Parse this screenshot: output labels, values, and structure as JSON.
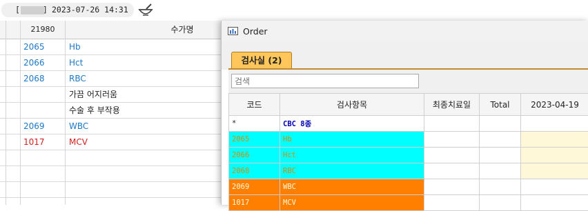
{
  "topbar": {
    "bracket_open": "[",
    "bracket_close": "]",
    "datetime": "2023-07-26 14:31",
    "bowl_icon": "mortar-pestle-icon"
  },
  "grid": {
    "header_code": "21980",
    "header_name": "수가명",
    "rows": [
      {
        "code": "2065",
        "name": "Hb",
        "color": "#1e78c8"
      },
      {
        "code": "2066",
        "name": "Hct",
        "color": "#1e78c8"
      },
      {
        "code": "2068",
        "name": "RBC",
        "color": "#1e78c8"
      },
      {
        "code": "",
        "name": "가끔 어지러움",
        "color": "#222222"
      },
      {
        "code": "",
        "name": "수술 후 부작용",
        "color": "#222222"
      },
      {
        "code": "2069",
        "name": "WBC",
        "color": "#1e78c8"
      },
      {
        "code": "1017",
        "name": "MCV",
        "color": "#d21e1e"
      }
    ]
  },
  "order_window": {
    "title": "Order",
    "tab_label": "검사실 (2)",
    "search_placeholder": "검색",
    "columns": [
      "코드",
      "검사항목",
      "최종치료일",
      "Total",
      "2023-04-19"
    ],
    "rows": [
      {
        "code": "*",
        "item": "CBC 8종",
        "style": "r-cbc"
      },
      {
        "code": "2065",
        "item": "Hb",
        "style": "r-cyan"
      },
      {
        "code": "2066",
        "item": "Hct",
        "style": "r-cyan"
      },
      {
        "code": "2068",
        "item": "RBC",
        "style": "r-cyan"
      },
      {
        "code": "2069",
        "item": "WBC",
        "style": "r-orange"
      },
      {
        "code": "1017",
        "item": "MCV",
        "style": "r-orange"
      }
    ]
  },
  "colors": {
    "tab_bg": "#ffc65c",
    "cyan_row": "#00ffff",
    "orange_row": "#ff8000",
    "date_highlight": "#fff8d8"
  }
}
